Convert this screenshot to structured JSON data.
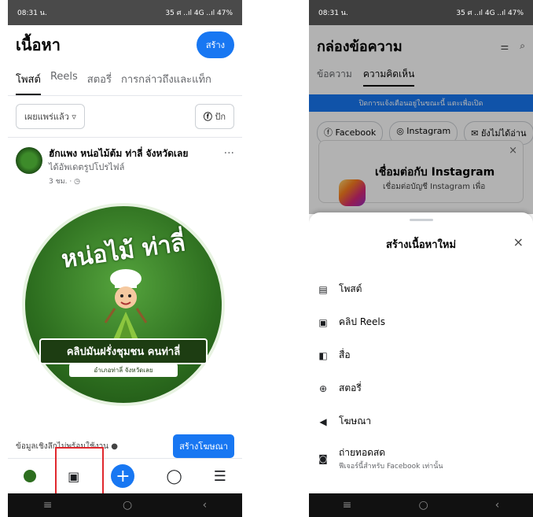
{
  "left": {
    "status": {
      "time": "08:31 น.",
      "right": "35 ศ ..ıl 4G ..ıl 47%"
    },
    "header": {
      "title": "เนื้อหา",
      "create_label": "สร้าง"
    },
    "tabs": [
      "โพสต์",
      "Reels",
      "สตอรี่",
      "การกล่าวถึงและแท็ก"
    ],
    "filters": {
      "published": "เผยแพร่แล้ว",
      "pin_label": "ปัก"
    },
    "post": {
      "name": "ฮักแพง หน่อไม้ต้ม ท่าลี่ จังหวัดเลย",
      "subtitle": "ได้อัพเดตรูปโปรไฟล์",
      "meta": "3 ชม. · ◷",
      "image_title": "หน่อไม้ ท่าลี่",
      "banner": "คลิปมันฝรั่งชุมชน คนท่าลี่",
      "banner_sub": "อำเภอท่าลี่ จังหวัดเลย"
    },
    "insight": {
      "text": "ข้อมูลเชิงลึกไม่พร้อมใช้งาน",
      "ad_button": "สร้างโฆษณา"
    }
  },
  "right": {
    "status": {
      "time": "08:31 น.",
      "right": "35 ศ ..ıl 4G ..ıl 47%"
    },
    "header": {
      "title": "กล่องข้อความ"
    },
    "tabs": [
      "ข้อความ",
      "ความคิดเห็น"
    ],
    "notice": "ปิดการแจ้งเตือนอยู่ในขณะนี้ แตะเพื่อเปิด",
    "platforms": [
      "Facebook",
      "Instagram",
      "ยังไม่ได้อ่าน"
    ],
    "ig_card": {
      "title": "เชื่อมต่อกับ Instagram",
      "subtitle": "เชื่อมต่อบัญชี Instagram เพื่อ"
    },
    "sheet": {
      "title": "สร้างเนื้อหาใหม่",
      "options": [
        {
          "label": "โพสต์",
          "icon": "post-icon"
        },
        {
          "label": "คลิป Reels",
          "icon": "reels-icon"
        },
        {
          "label": "สื่อ",
          "icon": "media-icon"
        },
        {
          "label": "สตอรี่",
          "icon": "story-icon"
        },
        {
          "label": "โฆษณา",
          "icon": "megaphone-icon"
        },
        {
          "label": "ถ่ายทอดสด",
          "icon": "live-icon",
          "subtitle": "ฟีเจอร์นี้สำหรับ Facebook เท่านั้น"
        }
      ]
    }
  },
  "colors": {
    "accent": "#1877f2",
    "highlight": "#e0282e"
  }
}
